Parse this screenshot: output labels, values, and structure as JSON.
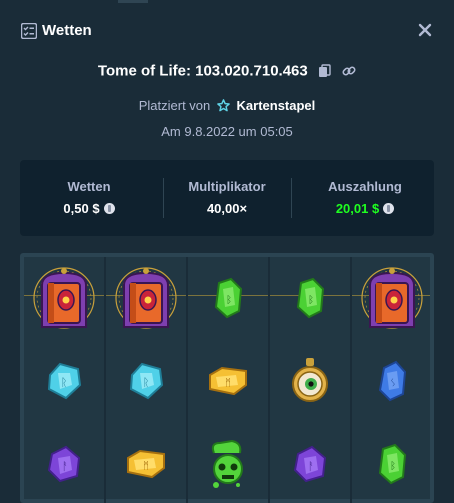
{
  "header": {
    "title": "Wetten",
    "icon": "bets-list-icon",
    "close_icon": "close-icon"
  },
  "game": {
    "label": "Tome of Life: 103.020.710.463",
    "copy_icon": "copy-icon",
    "link_icon": "link-icon"
  },
  "placed": {
    "prefix": "Platziert von",
    "user": "Kartenstapel",
    "user_icon": "vip-star-icon"
  },
  "date": "Am 9.8.2022 um 05:05",
  "stats": {
    "wager_label": "Wetten",
    "wager_value": "0,50 $",
    "multiplier_label": "Multiplikator",
    "multiplier_value": "40,00×",
    "payout_label": "Auszahlung",
    "payout_value": "20,01 $",
    "currency_icon": "litecoin-icon",
    "payout_color": "#1fff20"
  },
  "board": {
    "columns": [
      [
        "tome-symbol",
        "cyan-gem",
        "purple-gem"
      ],
      [
        "tome-symbol",
        "cyan-gem",
        "yellow-gem"
      ],
      [
        "green-gem",
        "yellow-gem",
        "green-potion-skull"
      ],
      [
        "green-gem",
        "eye-amulet",
        "purple-gem"
      ],
      [
        "tome-symbol",
        "blue-gem",
        "green-gem"
      ]
    ]
  }
}
